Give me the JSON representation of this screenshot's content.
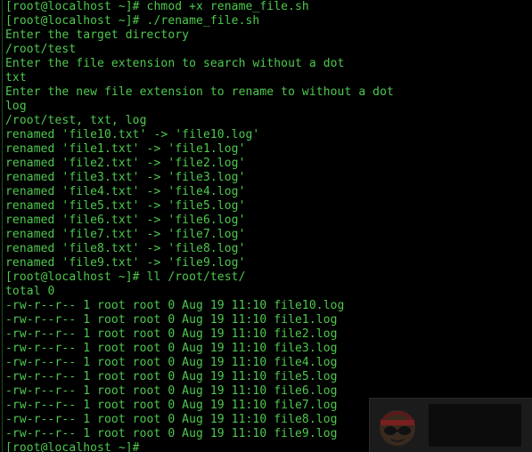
{
  "terminal": {
    "lines": [
      "[root@localhost ~]# chmod +x rename_file.sh",
      "[root@localhost ~]# ./rename_file.sh",
      "Enter the target directory",
      "/root/test",
      "Enter the file extension to search without a dot",
      "txt",
      "Enter the new file extension to rename to without a dot",
      "log",
      "/root/test, txt, log",
      "renamed 'file10.txt' -> 'file10.log'",
      "renamed 'file1.txt' -> 'file1.log'",
      "renamed 'file2.txt' -> 'file2.log'",
      "renamed 'file3.txt' -> 'file3.log'",
      "renamed 'file4.txt' -> 'file4.log'",
      "renamed 'file5.txt' -> 'file5.log'",
      "renamed 'file6.txt' -> 'file6.log'",
      "renamed 'file7.txt' -> 'file7.log'",
      "renamed 'file8.txt' -> 'file8.log'",
      "renamed 'file9.txt' -> 'file9.log'",
      "[root@localhost ~]# ll /root/test/",
      "total 0",
      "-rw-r--r-- 1 root root 0 Aug 19 11:10 file10.log",
      "-rw-r--r-- 1 root root 0 Aug 19 11:10 file1.log",
      "-rw-r--r-- 1 root root 0 Aug 19 11:10 file2.log",
      "-rw-r--r-- 1 root root 0 Aug 19 11:10 file3.log",
      "-rw-r--r-- 1 root root 0 Aug 19 11:10 file4.log",
      "-rw-r--r-- 1 root root 0 Aug 19 11:10 file5.log",
      "-rw-r--r-- 1 root root 0 Aug 19 11:10 file6.log",
      "-rw-r--r-- 1 root root 0 Aug 19 11:10 file7.log",
      "-rw-r--r-- 1 root root 0 Aug 19 11:10 file8.log",
      "-rw-r--r-- 1 root root 0 Aug 19 11:10 file9.log",
      "[root@localhost ~]#"
    ]
  },
  "colors": {
    "background": "#000000",
    "text": "#4ec94e"
  }
}
